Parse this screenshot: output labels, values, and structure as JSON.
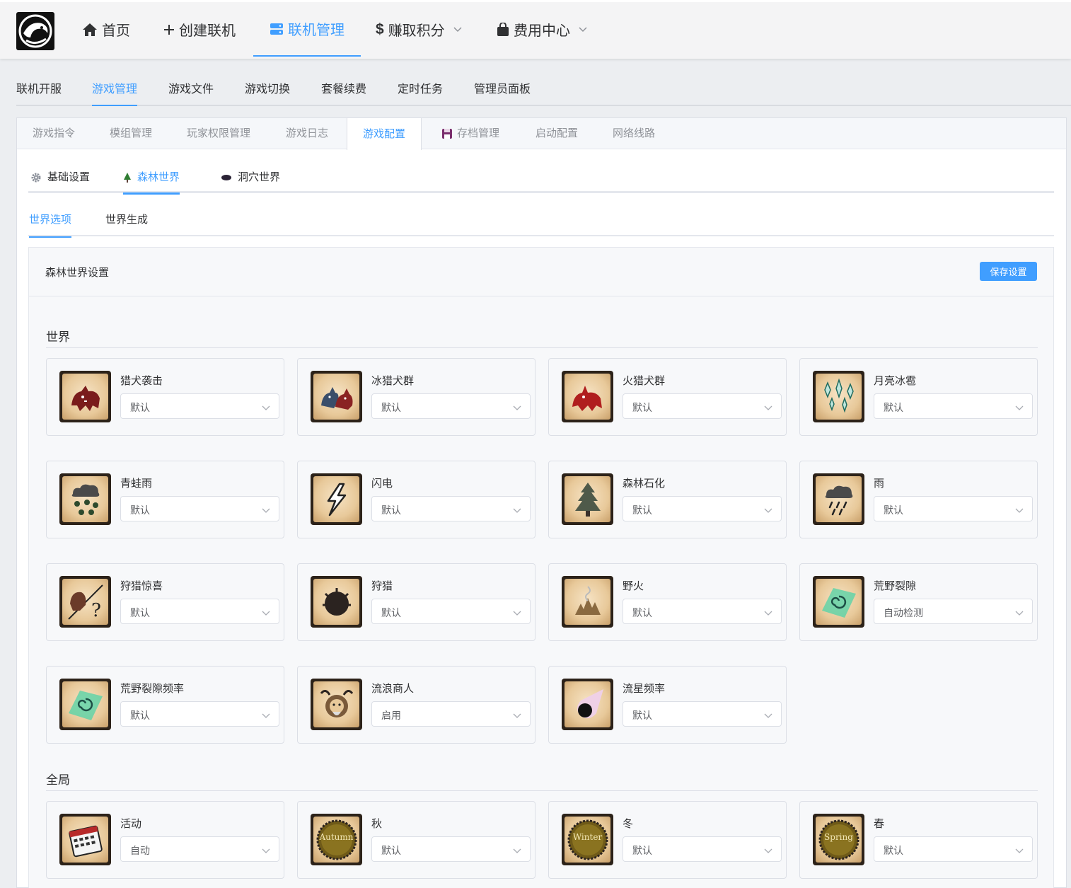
{
  "nav": {
    "items": [
      {
        "label": "首页",
        "icon": "home-icon"
      },
      {
        "label": "创建联机",
        "icon": "plus-icon"
      },
      {
        "label": "联机管理",
        "icon": "server-icon",
        "active": true
      },
      {
        "label": "赚取积分",
        "icon": "dollar-icon",
        "dropdown": true
      },
      {
        "label": "费用中心",
        "icon": "bag-icon",
        "dropdown": true
      }
    ]
  },
  "tabs_main": [
    "联机开服",
    "游戏管理",
    "游戏文件",
    "游戏切换",
    "套餐续费",
    "定时任务",
    "管理员面板"
  ],
  "tabs_game": [
    "游戏指令",
    "模组管理",
    "玩家权限管理",
    "游戏日志",
    "游戏配置",
    "存档管理",
    "启动配置",
    "网络线路"
  ],
  "tabs_config": [
    "基础设置",
    "森林世界",
    "洞穴世界"
  ],
  "tabs_world": [
    "世界选项",
    "世界生成"
  ],
  "card": {
    "title": "森林世界设置",
    "save_label": "保存设置"
  },
  "sections": [
    {
      "title": "世界",
      "options": [
        {
          "label": "猎犬袭击",
          "value": "默认",
          "icon": "hound-icon"
        },
        {
          "label": "冰猎犬群",
          "value": "默认",
          "icon": "ice-hound-icon"
        },
        {
          "label": "火猎犬群",
          "value": "默认",
          "icon": "fire-hound-icon"
        },
        {
          "label": "月亮冰雹",
          "value": "默认",
          "icon": "moon-hail-icon"
        },
        {
          "label": "青蛙雨",
          "value": "默认",
          "icon": "frog-rain-icon"
        },
        {
          "label": "闪电",
          "value": "默认",
          "icon": "lightning-icon"
        },
        {
          "label": "森林石化",
          "value": "默认",
          "icon": "petrified-tree-icon"
        },
        {
          "label": "雨",
          "value": "默认",
          "icon": "rain-icon"
        },
        {
          "label": "狩猎惊喜",
          "value": "默认",
          "icon": "hunt-surprise-icon"
        },
        {
          "label": "狩猎",
          "value": "默认",
          "icon": "hunt-icon"
        },
        {
          "label": "野火",
          "value": "默认",
          "icon": "wildfire-icon"
        },
        {
          "label": "荒野裂隙",
          "value": "自动检测",
          "icon": "rift-icon"
        },
        {
          "label": "荒野裂隙频率",
          "value": "默认",
          "icon": "rift-frequency-icon"
        },
        {
          "label": "流浪商人",
          "value": "启用",
          "icon": "wandering-trader-icon"
        },
        {
          "label": "流星频率",
          "value": "默认",
          "icon": "meteor-icon"
        }
      ]
    },
    {
      "title": "全局",
      "options": [
        {
          "label": "活动",
          "value": "自动",
          "icon": "calendar-icon"
        },
        {
          "label": "秋",
          "value": "默认",
          "icon": "autumn-icon",
          "badge": "Autumn"
        },
        {
          "label": "冬",
          "value": "默认",
          "icon": "winter-icon",
          "badge": "Winter"
        },
        {
          "label": "春",
          "value": "默认",
          "icon": "spring-icon",
          "badge": "Spring"
        }
      ]
    }
  ],
  "colors": {
    "accent": "#409eff",
    "text": "#303133",
    "muted": "#909399"
  }
}
